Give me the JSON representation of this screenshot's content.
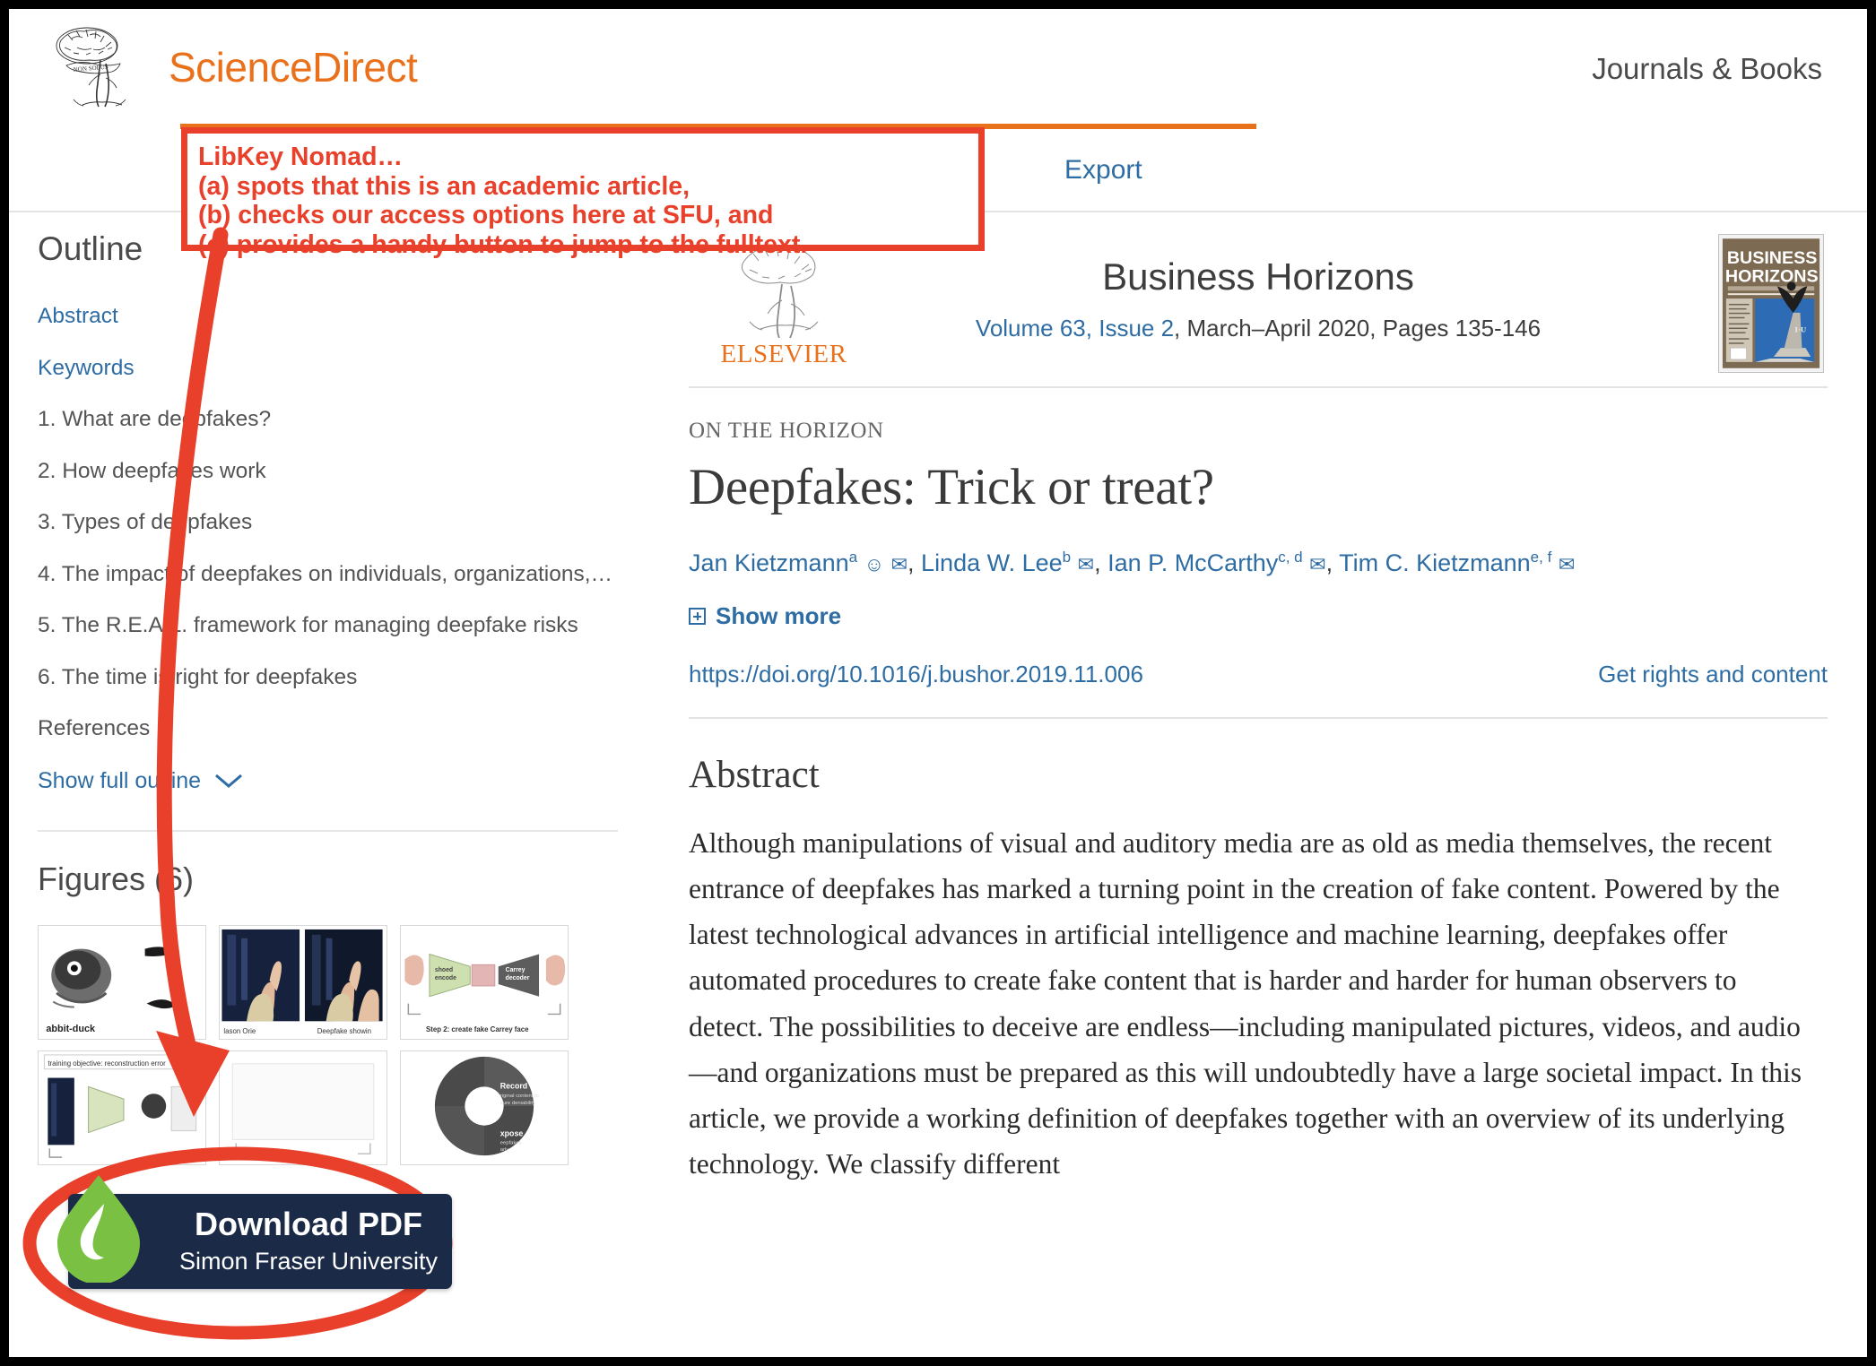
{
  "colors": {
    "annotation_red": "#E8402A",
    "sciencedirect_orange": "#E9711C",
    "link_blue": "#2e6ca4",
    "libkey_navy": "#1B2A47",
    "libkey_green": "#7AC143"
  },
  "header": {
    "brand": "ScienceDirect",
    "journals_books": "Journals & Books"
  },
  "toolbar": {
    "export": "Export"
  },
  "annotation": {
    "lines": [
      "LibKey Nomad…",
      "(a) spots that this is an academic article,",
      "(b) checks our access options here at SFU, and",
      "(c) provides a handy button to jump to the fulltext."
    ]
  },
  "sidebar": {
    "outline_title": "Outline",
    "outline_items": [
      {
        "label": "Abstract",
        "is_link": true
      },
      {
        "label": "Keywords",
        "is_link": true
      },
      {
        "label": "1. What are deepfakes?",
        "is_link": false
      },
      {
        "label": "2. How deepfakes work",
        "is_link": false
      },
      {
        "label": "3. Types of deepfakes",
        "is_link": false
      },
      {
        "label": "4. The impact of deepfakes on individuals, organizations,…",
        "is_link": false
      },
      {
        "label": "5. The R.E.A.L. framework for managing deepfake risks",
        "is_link": false
      },
      {
        "label": "6. The time is right for deepfakes",
        "is_link": false
      },
      {
        "label": "References",
        "is_link": false
      }
    ],
    "show_full_outline": "Show full outline",
    "figures_title": "Figures (6)",
    "figure_captions": [
      "abbit-duck",
      "lason Orie / Deepfake showin",
      "Step 2: create fake Carrey face",
      "training objective: reconstruction error",
      "",
      "Record / Expose"
    ]
  },
  "journal": {
    "publisher": "ELSEVIER",
    "name": "Business Horizons",
    "volume_issue": "Volume 63, Issue 2",
    "issue_rest": ", March–April 2020, Pages 135-146",
    "cover_line1": "BUSINESS",
    "cover_line2": "HORIZONS"
  },
  "article": {
    "kicker": "ON THE HORIZON",
    "title": "Deepfakes: Trick or treat?",
    "authors": [
      {
        "name": "Jan Kietzmann",
        "sup": "a",
        "icons": "person envelope"
      },
      {
        "name": "Linda W. Lee",
        "sup": "b",
        "icons": "envelope"
      },
      {
        "name": "Ian P. McCarthy",
        "sup": "c, d",
        "icons": "envelope"
      },
      {
        "name": "Tim C. Kietzmann",
        "sup": "e, f",
        "icons": "envelope"
      }
    ],
    "show_more": "Show more",
    "doi": "https://doi.org/10.1016/j.bushor.2019.11.006",
    "rights": "Get rights and content",
    "abstract_heading": "Abstract",
    "abstract_text": "Although manipulations of visual and auditory media are as old as media themselves, the recent entrance of deepfakes has marked a turning point in the creation of fake content. Powered by the latest technological advances in artificial intelligence and machine learning, deepfakes offer automated procedures to create fake content that is harder and harder for human observers to detect. The possibilities to deceive are endless—including manipulated pictures, videos, and audio—and organizations must be prepared as this will undoubtedly have a large societal impact. In this article, we provide a working definition of deepfakes together with an overview of its underlying technology. We classify different"
  },
  "libkey": {
    "title": "Download PDF",
    "subtitle": "Simon Fraser University"
  }
}
